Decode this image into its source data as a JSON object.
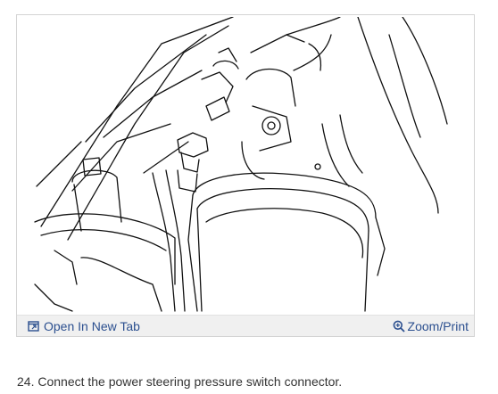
{
  "figure": {
    "illustration_icon": "engine-line-drawing"
  },
  "toolbar": {
    "open_tab": {
      "label": "Open In New Tab",
      "icon": "open-new-tab-icon"
    },
    "zoom": {
      "label": "Zoom/Print",
      "icon": "zoom-icon"
    }
  },
  "step": {
    "text": "24. Connect the power steering pressure switch connector."
  },
  "colors": {
    "link": "#2b4f8f",
    "toolbar_bg": "#f0f0f0",
    "body_text": "#333333",
    "border": "#d4d4d4"
  }
}
